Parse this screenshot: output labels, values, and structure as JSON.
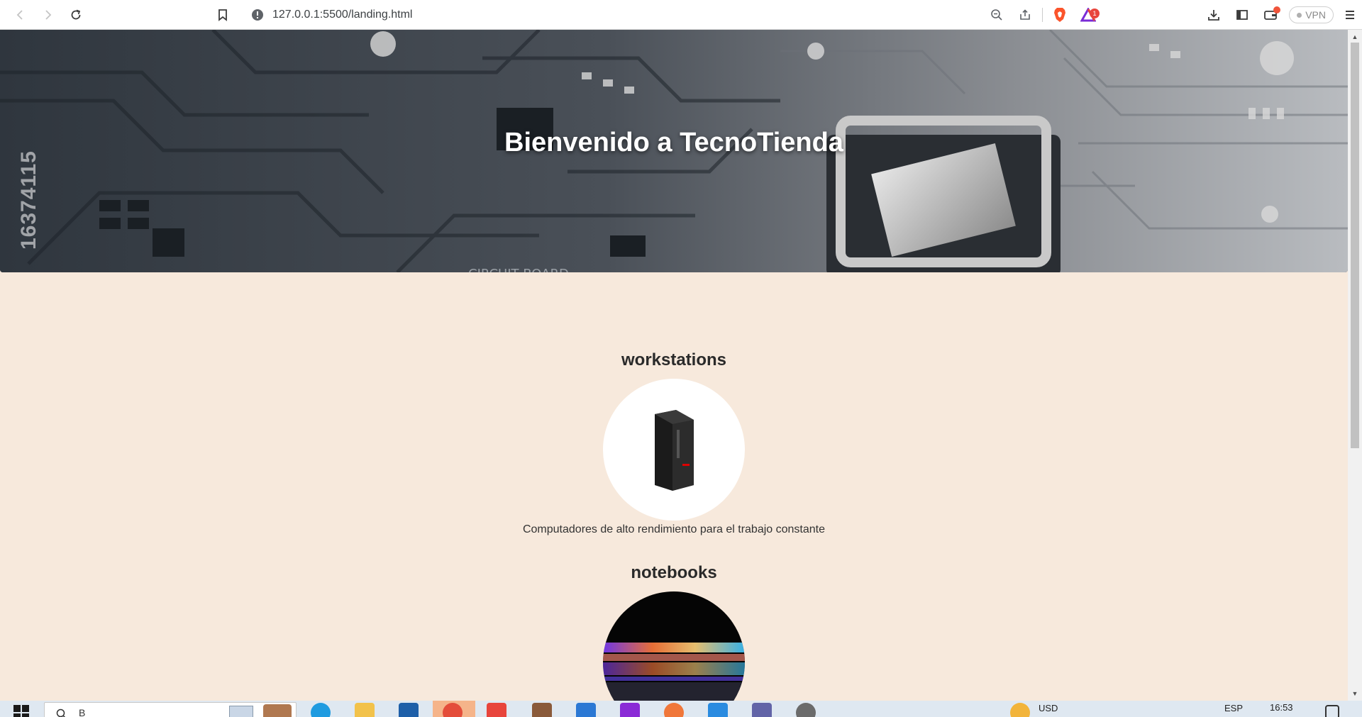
{
  "browser": {
    "url": "127.0.0.1:5500/landing.html",
    "vpn_label": "VPN",
    "brave_rewards_count": "1"
  },
  "hero": {
    "title": "Bienvenido a TecnoTienda",
    "watermark": "16374115",
    "board_label": "CIRCUIT BOARD"
  },
  "categories": [
    {
      "title": "workstations",
      "description": "Computadores de alto rendimiento para el trabajo constante"
    },
    {
      "title": "notebooks",
      "description": ""
    }
  ],
  "taskbar": {
    "search_placeholder": "B",
    "tray_currency": "USD",
    "tray_lang": "ESP",
    "clock": "16:53"
  },
  "colors": {
    "page_background": "#f7e9dc",
    "heading": "#2a2a2a"
  }
}
